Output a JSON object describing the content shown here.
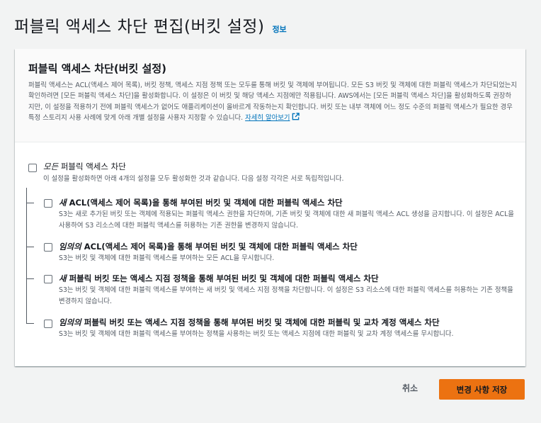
{
  "header": {
    "title": "퍼블릭 액세스 차단 편집(버킷 설정)",
    "info_link": "정보"
  },
  "panel": {
    "title": "퍼블릭 액세스 차단(버킷 설정)",
    "description": "퍼블릭 액세스는 ACL(액세스 제어 목록), 버킷 정책, 액세스 지점 정책 또는 모두를 통해 버킷 및 객체에 부여됩니다. 모든 S3 버킷 및 객체에 대한 퍼블릭 액세스가 차단되었는지 확인하려면 [모든 퍼블릭 액세스 차단]을 활성화합니다. 이 설정은 이 버킷 및 해당 액세스 지점에만 적용됩니다. AWS에서는 [모든 퍼블릭 액세스 차단]을 활성화하도록 권장하지만, 이 설정을 적용하기 전에 퍼블릭 액세스가 없어도 애플리케이션이 올바르게 작동하는지 확인합니다. 버킷 또는 내부 객체에 어느 정도 수준의 퍼블릭 액세스가 필요한 경우 특정 스토리지 사용 사례에 맞게 아래 개별 설정을 사용자 지정할 수 있습니다.",
    "learn_more_link": "자세히 알아보기"
  },
  "options": {
    "all": {
      "label_emph": "모든",
      "label_rest": " 퍼블릭 액세스 차단",
      "description": "이 설정을 활성화하면 아래 4개의 설정을 모두 활성화한 것과 같습니다. 다음 설정 각각은 서로 독립적입니다.",
      "checked": false
    },
    "new_acl": {
      "label_emph": "새",
      "label_rest": " ACL(액세스 제어 목록)을 통해 부여된 버킷 및 객체에 대한 퍼블릭 액세스 차단",
      "description": "S3는 새로 추가된 버킷 또는 객체에 적용되는 퍼블릭 액세스 권한을 차단하며, 기존 버킷 및 객체에 대한 새 퍼블릭 액세스 ACL 생성을 금지합니다. 이 설정은 ACL을 사용하여 S3 리소스에 대한 퍼블릭 액세스를 허용하는 기존 권한을 변경하지 않습니다.",
      "checked": false
    },
    "any_acl": {
      "label_emph": "임의의",
      "label_rest": " ACL(액세스 제어 목록)을 통해 부여된 버킷 및 객체에 대한 퍼블릭 액세스 차단",
      "description": "S3는 버킷 및 객체에 대한 퍼블릭 액세스를 부여하는 모든 ACL을 무시합니다.",
      "checked": false
    },
    "new_policy": {
      "label_emph": "새",
      "label_rest": " 퍼블릭 버킷 또는 액세스 지점 정책을 통해 부여된 버킷 및 객체에 대한 퍼블릭 액세스 차단",
      "description": "S3는 버킷 및 객체에 대한 퍼블릭 액세스를 부여하는 새 버킷 및 액세스 지점 정책을 차단합니다. 이 설정은 S3 리소스에 대한 퍼블릭 액세스를 허용하는 기존 정책을 변경하지 않습니다.",
      "checked": false
    },
    "any_policy": {
      "label_emph": "임의의",
      "label_rest": " 퍼블릭 버킷 또는 액세스 지점 정책을 통해 부여된 버킷 및 객체에 대한 퍼블릭 및 교차 계정 액세스 차단",
      "description": "S3는 버킷 및 객체에 대한 퍼블릭 액세스를 부여하는 정책을 사용하는 버킷 또는 액세스 지점에 대한 퍼블릭 및 교차 계정 액세스를 무시합니다.",
      "checked": false
    }
  },
  "footer": {
    "cancel_label": "취소",
    "save_label": "변경 사항 저장"
  },
  "colors": {
    "accent": "#ec7211",
    "link": "#0073bb",
    "background": "#f2f3f3"
  }
}
